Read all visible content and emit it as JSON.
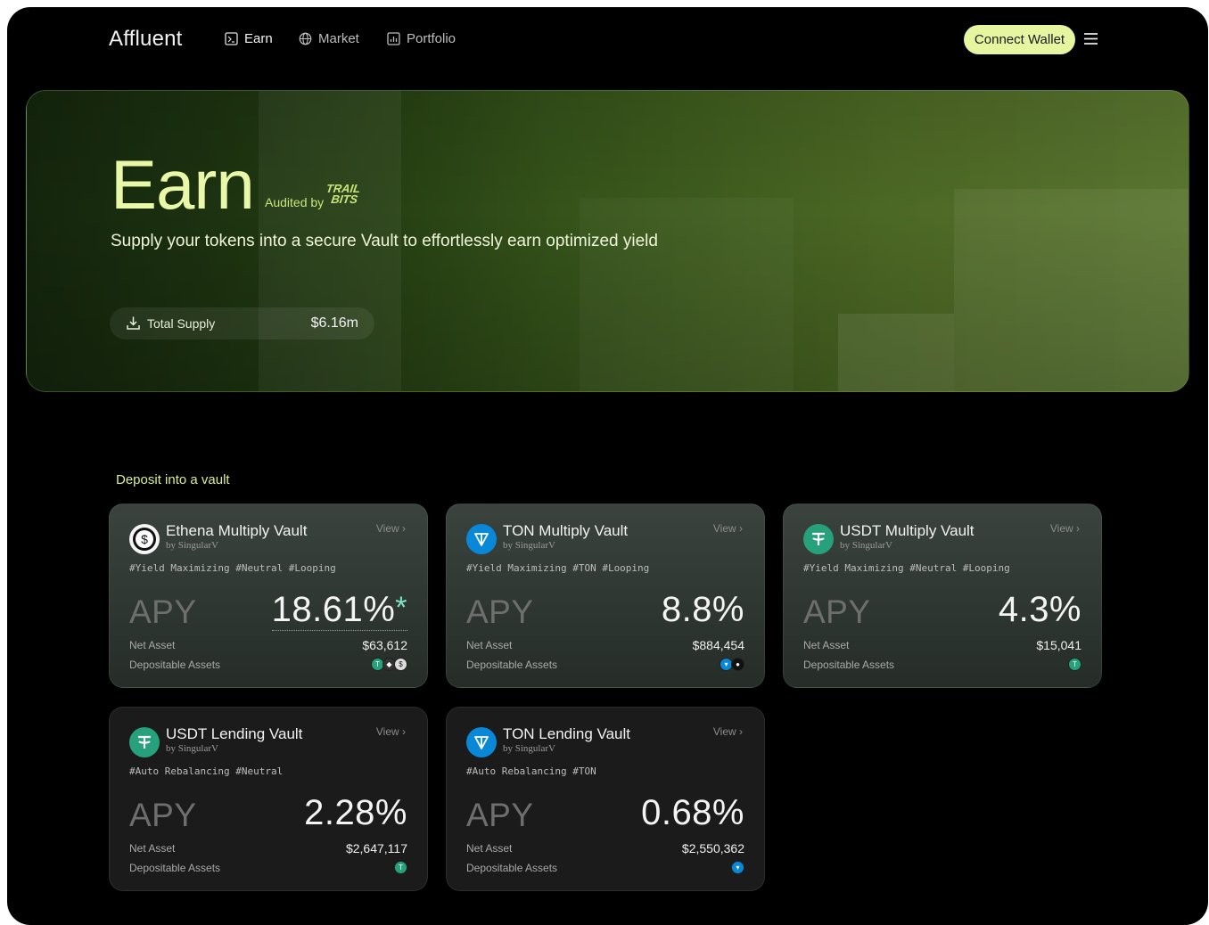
{
  "nav": {
    "logo": "Affluent",
    "links": [
      {
        "label": "Earn",
        "icon": "earn-icon",
        "active": true
      },
      {
        "label": "Market",
        "icon": "globe-icon",
        "active": false
      },
      {
        "label": "Portfolio",
        "icon": "chart-icon",
        "active": false
      }
    ],
    "connect_label": "Connect Wallet",
    "menu_icon": "hamburger-menu-icon"
  },
  "hero": {
    "title": "Earn",
    "audited_by": "Audited by",
    "auditor_logo": "TRAIL BITS",
    "subtitle": "Supply your tokens into a secure Vault to effortlessly earn optimized yield",
    "total_supply_label": "Total Supply",
    "total_supply_value": "$6.16m"
  },
  "section": {
    "title": "Deposit into a vault"
  },
  "common": {
    "view": "View",
    "apy": "APY",
    "net_asset": "Net Asset",
    "depositable": "Depositable Assets"
  },
  "vaults": [
    {
      "name": "Ethena Multiply Vault",
      "by": "by SingularV",
      "tags": "#Yield Maximizing #Neutral #Looping",
      "apy": "18.61%",
      "star": "*",
      "net_asset": "$63,612",
      "token": "usde",
      "deposit_icons": [
        "usdt",
        "ton",
        "usde"
      ]
    },
    {
      "name": "TON Multiply Vault",
      "by": "by SingularV",
      "tags": "#Yield Maximizing #TON #Looping",
      "apy": "8.8%",
      "net_asset": "$884,454",
      "token": "ton",
      "deposit_icons": [
        "ton",
        "ston"
      ]
    },
    {
      "name": "USDT Multiply Vault",
      "by": "by SingularV",
      "tags": "#Yield Maximizing #Neutral #Looping",
      "apy": "4.3%",
      "net_asset": "$15,041",
      "token": "usdt",
      "deposit_icons": [
        "usdt"
      ]
    },
    {
      "name": "USDT Lending Vault",
      "by": "by SingularV",
      "tags": "#Auto Rebalancing #Neutral",
      "apy": "2.28%",
      "net_asset": "$2,647,117",
      "token": "usdt",
      "deposit_icons": [
        "usdt"
      ]
    },
    {
      "name": "TON Lending Vault",
      "by": "by SingularV",
      "tags": "#Auto Rebalancing #TON",
      "apy": "0.68%",
      "net_asset": "$2,550,362",
      "token": "ton",
      "deposit_icons": [
        "ton"
      ]
    }
  ],
  "colors": {
    "accent": "#e6f5a0",
    "usdt": "#26a17b",
    "ton": "#0a88d8"
  }
}
